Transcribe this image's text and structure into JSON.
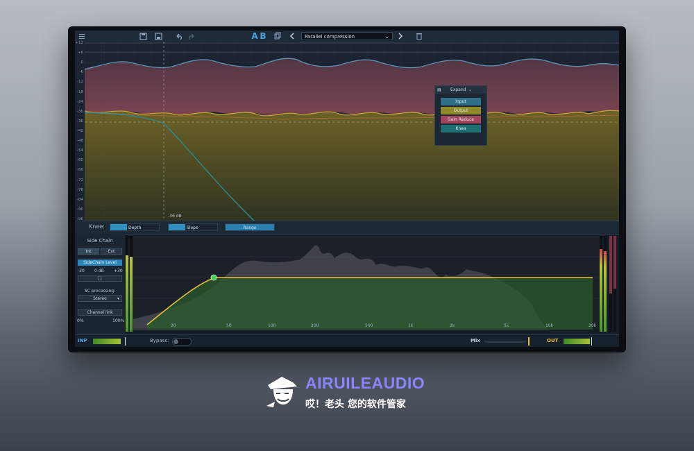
{
  "toolbar": {
    "preset_name": "Parallel compression",
    "ab_a": "A",
    "ab_b": "B"
  },
  "graph": {
    "db_scale": [
      "+12",
      "+6",
      "0",
      "-6",
      "-12",
      "-18",
      "-24",
      "-30",
      "-36",
      "-42",
      "-48",
      "-54",
      "-60",
      "-66",
      "-72",
      "-78",
      "-84",
      "-90",
      "-96"
    ],
    "cursor_label": "-36 dB"
  },
  "popup": {
    "mode": "Expand",
    "items": [
      {
        "label": "Input",
        "color": "#2f6f88"
      },
      {
        "label": "Output",
        "color": "#8e8a2a"
      },
      {
        "label": "Gain Reduce",
        "color": "#a0455a"
      },
      {
        "label": "Knee",
        "color": "#1e6e72"
      }
    ]
  },
  "knee": {
    "label": "Knee:",
    "depth": "Depth",
    "slope": "Slope",
    "range": "Range"
  },
  "sidechain": {
    "title": "Side Chain",
    "int": "Int",
    "ext": "Ext",
    "level_label": "SideChain Level",
    "level_min": "-30",
    "level_value": "0 dB",
    "level_max": "+30",
    "processing_label": "SC processing:",
    "processing_value": "Stereo",
    "channel_link": "Channel link",
    "link_min": "0%",
    "link_max": "100%"
  },
  "freq_axis": [
    "20",
    "50",
    "100",
    "200",
    "500",
    "1k",
    "2k",
    "5k",
    "10k",
    "20k"
  ],
  "bottom": {
    "inp": "INP",
    "bypass": "Bypass:",
    "mix": "Mix",
    "out": "OUT"
  },
  "brand": {
    "name": "AIRUILEAUDIO",
    "tagline": "哎！老头 您的软件管家"
  },
  "colors": {
    "accent_blue": "#2b85b8",
    "output_yellow": "#e8c13a",
    "brand_purple": "#8c84ff"
  }
}
